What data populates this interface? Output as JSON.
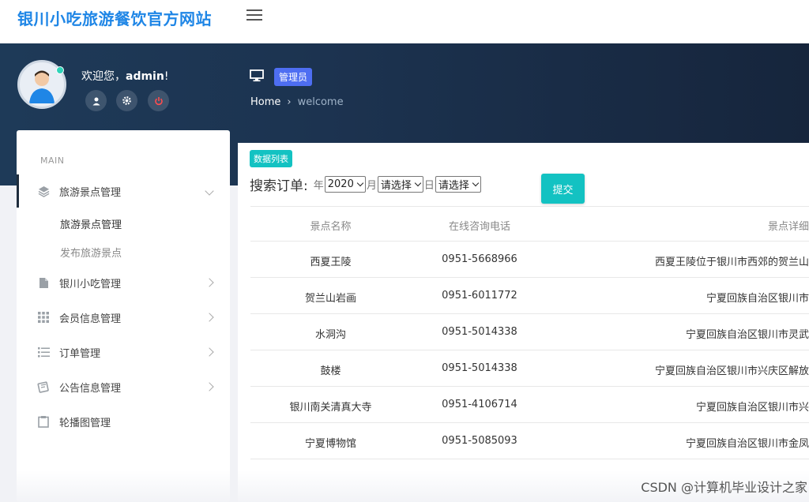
{
  "brand": {
    "title": "银川小吃旅游餐饮官方网站"
  },
  "user": {
    "welcome": "欢迎您，",
    "name": "admin",
    "suffix": "!"
  },
  "header": {
    "role_badge": "管理员",
    "breadcrumb": {
      "home": "Home",
      "current": "welcome"
    }
  },
  "sidebar": {
    "section_label": "MAIN",
    "items": [
      {
        "label": "旅游景点管理",
        "icon": "layers-icon",
        "expanded": true,
        "children": [
          {
            "label": "旅游景点管理"
          },
          {
            "label": "发布旅游景点"
          }
        ]
      },
      {
        "label": "银川小吃管理",
        "icon": "document-icon"
      },
      {
        "label": "会员信息管理",
        "icon": "grid-icon"
      },
      {
        "label": "订单管理",
        "icon": "list-icon"
      },
      {
        "label": "公告信息管理",
        "icon": "announcement-icon"
      },
      {
        "label": "轮播图管理",
        "icon": "clipboard-icon"
      }
    ]
  },
  "main": {
    "list_badge": "数据列表",
    "search": {
      "title": "搜索订单:",
      "year_unit": "年",
      "year_value": "2020",
      "month_unit": "月",
      "month_value": "请选择",
      "day_unit": "日",
      "day_value": "请选择",
      "submit_label": "提交"
    },
    "table": {
      "columns": [
        "景点名称",
        "在线咨询电话",
        "景点详细"
      ],
      "rows": [
        {
          "name": "西夏王陵",
          "phone": "0951-5668966",
          "detail": "西夏王陵位于银川市西郊的贺兰山"
        },
        {
          "name": "贺兰山岩画",
          "phone": "0951-6011772",
          "detail": "宁夏回族自治区银川市"
        },
        {
          "name": "水洞沟",
          "phone": "0951-5014338",
          "detail": "宁夏回族自治区银川市灵武"
        },
        {
          "name": "鼓楼",
          "phone": "0951-5014338",
          "detail": "宁夏回族自治区银川市兴庆区解放"
        },
        {
          "name": "银川南关清真大寺",
          "phone": "0951-4106714",
          "detail": "宁夏回族自治区银川市兴"
        },
        {
          "name": "宁夏博物馆",
          "phone": "0951-5085093",
          "detail": "宁夏回族自治区银川市金凤"
        }
      ]
    }
  },
  "watermark": "CSDN @计算机毕业设计之家",
  "colors": {
    "brand": "#1f86e6",
    "accent": "#13c2c2",
    "badge": "#4e6ef2",
    "band": "#1e3a58"
  }
}
